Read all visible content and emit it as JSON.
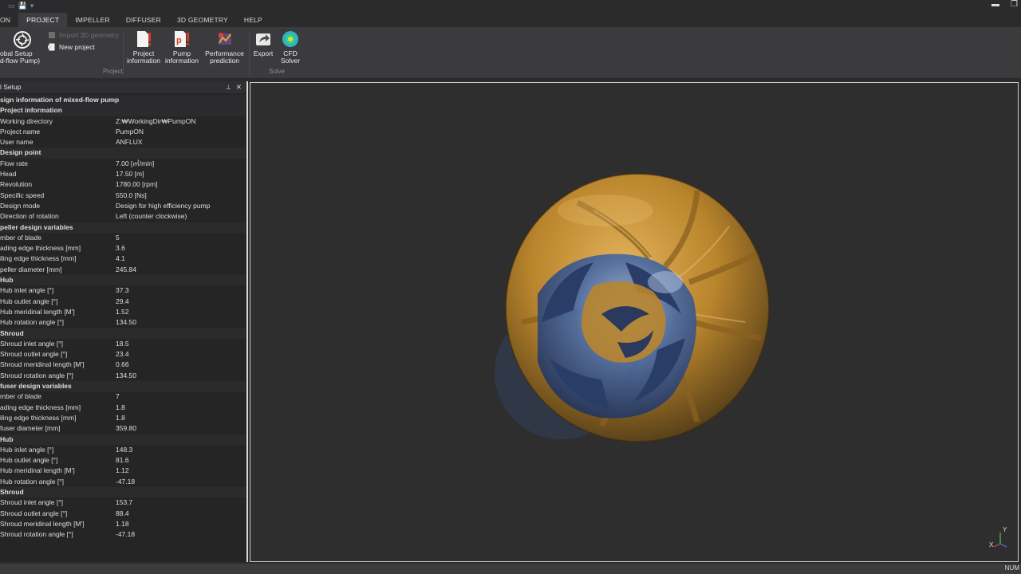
{
  "titlebar": {
    "minimize": "▬",
    "restore": "❐"
  },
  "tabs": [
    {
      "label": "ON",
      "active": false
    },
    {
      "label": "PROJECT",
      "active": true
    },
    {
      "label": "IMPELLER",
      "active": false
    },
    {
      "label": "DIFFUSER",
      "active": false
    },
    {
      "label": "3D GEOMETRY",
      "active": false
    },
    {
      "label": "HELP",
      "active": false
    }
  ],
  "ribbon": {
    "global_setup": {
      "line1": "obal Setup",
      "line2": "d-flow Pump)"
    },
    "import_geometry": "Import 3D geometry",
    "new_project": "New project",
    "project_info": {
      "line1": "Project",
      "line2": "information"
    },
    "pump_info": {
      "line1": "Pump",
      "line2": "information"
    },
    "performance": {
      "line1": "Performance",
      "line2": "prediction"
    },
    "export": "Export",
    "cfd": {
      "line1": "CFD",
      "line2": "Solver"
    },
    "group_project": "Project",
    "group_solve": "Solve"
  },
  "panel": {
    "title": "l Setup",
    "pin": "📌",
    "close": "✕",
    "rows": [
      {
        "cat": true,
        "k": "sign information of mixed-flow pump"
      },
      {
        "cat": true,
        "k": "Project information"
      },
      {
        "k": "Working directory",
        "v": "Z:₩WorkingDir₩PumpON"
      },
      {
        "k": "Project name",
        "v": "PumpON"
      },
      {
        "k": "User name",
        "v": "ANFLUX"
      },
      {
        "cat": true,
        "k": "Design point"
      },
      {
        "k": "Flow rate",
        "v": "7.00 [㎥/min]"
      },
      {
        "k": "Head",
        "v": "17.50 [m]"
      },
      {
        "k": "Revolution",
        "v": "1780.00 [rpm]"
      },
      {
        "k": "Specific speed",
        "v": "550.0 [Ns]"
      },
      {
        "k": "Design mode",
        "v": "Design for high efficiency pump"
      },
      {
        "k": "Direction of rotation",
        "v": "Left (counter clockwise)"
      },
      {
        "cat": true,
        "k": "peller design variables"
      },
      {
        "k": "mber of blade",
        "v": "5"
      },
      {
        "k": "ading edge thickness [mm]",
        "v": "3.6"
      },
      {
        "k": "iling edge thickness [mm]",
        "v": "4.1"
      },
      {
        "k": "peller diameter [mm]",
        "v": "245.84"
      },
      {
        "cat": true,
        "k": "Hub"
      },
      {
        "k": "Hub inlet angle [°]",
        "v": "37.3"
      },
      {
        "k": "Hub outlet angle [°]",
        "v": "29.4"
      },
      {
        "k": "Hub meridinal length [M']",
        "v": "1.52"
      },
      {
        "k": "Hub rotation angle [°]",
        "v": "134.50"
      },
      {
        "cat": true,
        "k": "Shroud"
      },
      {
        "k": "Shroud inlet angle [°]",
        "v": "18.5"
      },
      {
        "k": "Shroud outlet angle [°]",
        "v": "23.4"
      },
      {
        "k": "Shroud meridinal length [M']",
        "v": "0.66"
      },
      {
        "k": "Shroud rotation angle [°]",
        "v": "134.50"
      },
      {
        "cat": true,
        "k": "fuser design variables"
      },
      {
        "k": "mber of blade",
        "v": "7"
      },
      {
        "k": "ading edge thickness [mm]",
        "v": "1.8"
      },
      {
        "k": "iling edge thickness [mm]",
        "v": "1.8"
      },
      {
        "k": "fuser diameter [mm]",
        "v": "359.80"
      },
      {
        "cat": true,
        "k": "Hub"
      },
      {
        "k": "Hub inlet angle [°]",
        "v": "148.3"
      },
      {
        "k": "Hub outlet angle [°]",
        "v": "81.6"
      },
      {
        "k": "Hub meridinal length [M']",
        "v": "1.12"
      },
      {
        "k": "Hub rotation angle [°]",
        "v": "-47.18"
      },
      {
        "cat": true,
        "k": "Shroud"
      },
      {
        "k": "Shroud inlet angle [°]",
        "v": "153.7"
      },
      {
        "k": "Shroud outlet angle [°]",
        "v": "88.4"
      },
      {
        "k": "Shroud meridinal length [M']",
        "v": "1.18"
      },
      {
        "k": "Shroud rotation angle [°]",
        "v": "-47.18"
      }
    ]
  },
  "viewport": {
    "axis_x": "X",
    "axis_y": "Y",
    "colors": {
      "diffuser": "#c7912f",
      "impeller": "#3f5f94"
    }
  },
  "status": {
    "num": "NUM"
  }
}
